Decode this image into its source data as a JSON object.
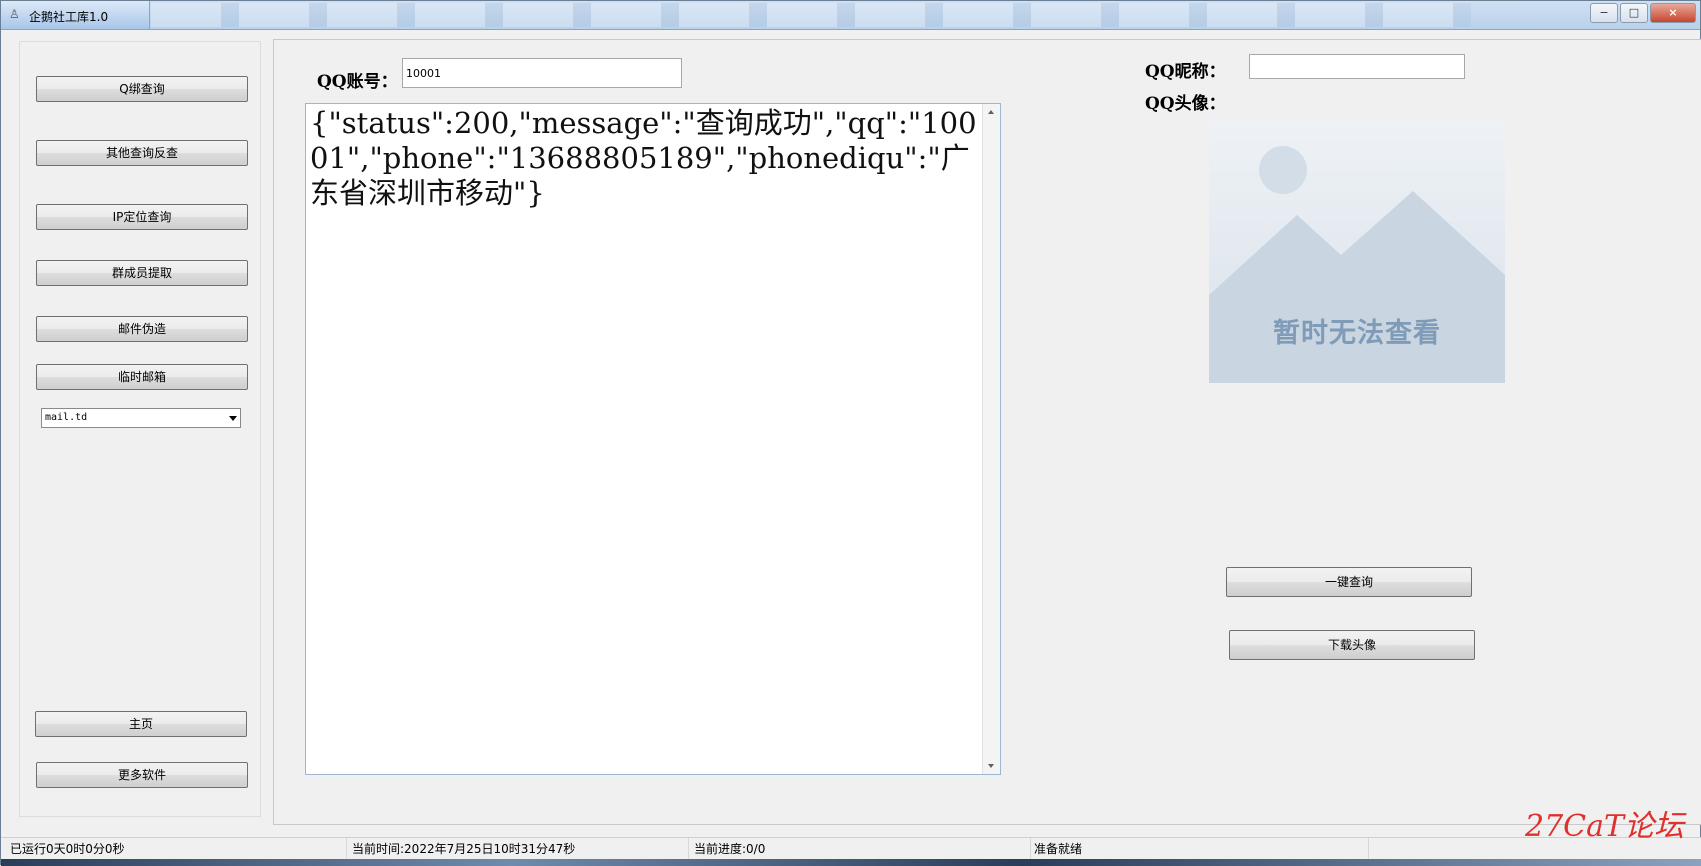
{
  "window": {
    "title": "企鹅社工库1.0",
    "controls": [
      "−",
      "□",
      "×"
    ]
  },
  "sidebar": {
    "buttons": [
      {
        "label": "Q绑查询"
      },
      {
        "label": "其他查询反查"
      },
      {
        "label": "IP定位查询"
      },
      {
        "label": "群成员提取"
      },
      {
        "label": "邮件伪造"
      },
      {
        "label": "临时邮箱"
      }
    ],
    "mail_select": {
      "value": "mail.td"
    },
    "bottom_buttons": [
      {
        "label": "主页"
      },
      {
        "label": "更多软件"
      }
    ]
  },
  "main": {
    "qq_account": {
      "label": "QQ账号：",
      "value": "10001"
    },
    "result_text": "{\"status\":200,\"message\":\"查询成功\",\"qq\":\"10001\",\"phone\":\"13688805189\",\"phonediqu\":\"广东省深圳市移动\"}",
    "qq_nickname": {
      "label": "QQ昵称：",
      "value": ""
    },
    "qq_avatar": {
      "label": "QQ头像：",
      "placeholder_text": "暂时无法查看"
    },
    "one_click_query_label": "一键查询",
    "download_avatar_label": "下载头像"
  },
  "status": {
    "runtime": "已运行0天0时0分0秒",
    "current_time": "当前时间:2022年7月25日10时31分47秒",
    "progress": "当前进度:0/0",
    "state": "准备就绪"
  },
  "watermark": "27CaT论坛"
}
